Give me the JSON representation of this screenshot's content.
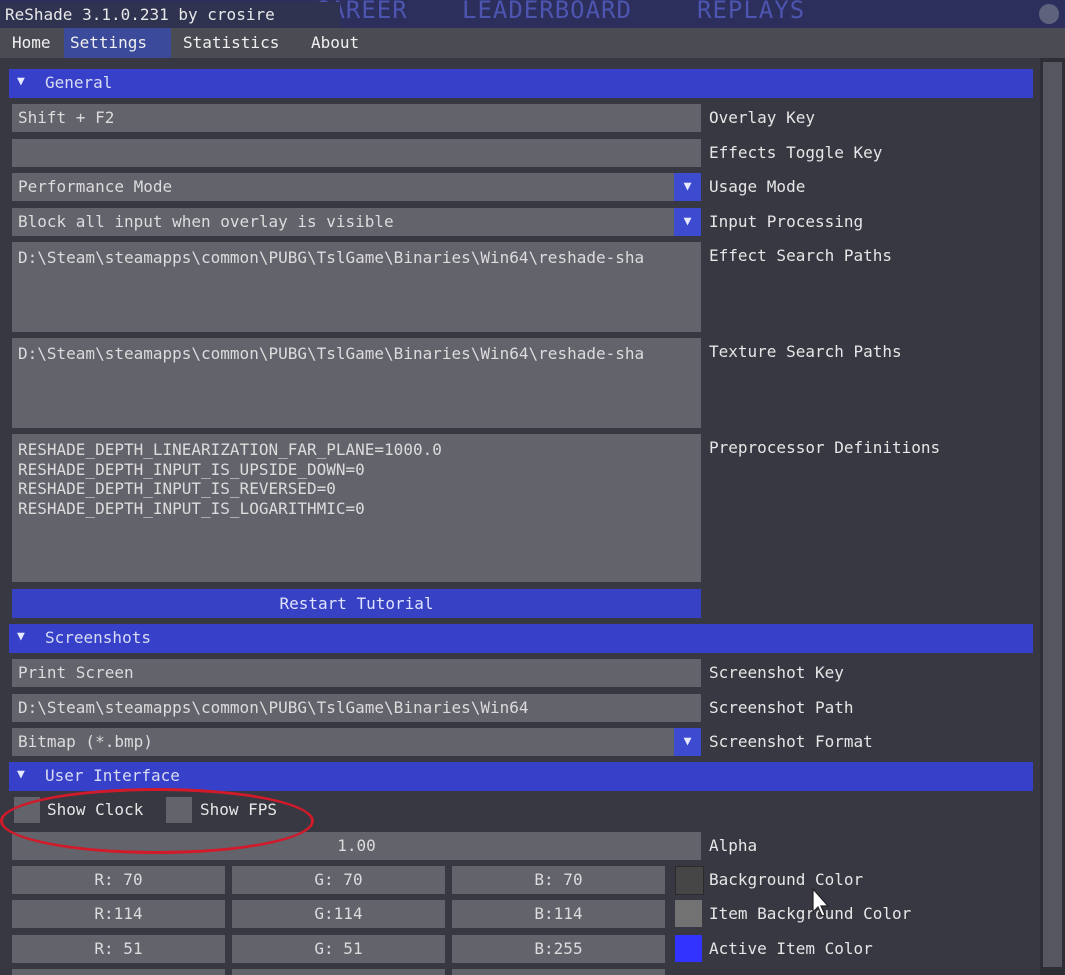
{
  "background_app": {
    "tabs": [
      "CAREER",
      "LEADERBOARD",
      "REPLAYS"
    ],
    "accent": "#4d55b0"
  },
  "window": {
    "title": "ReShade 3.1.0.231 by crosire"
  },
  "menu": {
    "items": [
      "Home",
      "Settings",
      "Statistics",
      "About"
    ],
    "active": "Settings"
  },
  "colors": {
    "section_header": "#3640c8",
    "field": "#62636b",
    "highlight_annotation": "#d11a2a"
  },
  "general": {
    "header": "General",
    "overlay_key": {
      "value": "Shift + F2",
      "label": "Overlay Key"
    },
    "effects_toggle_key": {
      "value": "",
      "label": "Effects Toggle Key"
    },
    "usage_mode": {
      "value": "Performance Mode",
      "label": "Usage Mode"
    },
    "input_processing": {
      "value": "Block all input when overlay is visible",
      "label": "Input Processing"
    },
    "effect_search_paths": {
      "value": "D:\\Steam\\steamapps\\common\\PUBG\\TslGame\\Binaries\\Win64\\reshade-sha",
      "label": "Effect Search Paths"
    },
    "texture_search_paths": {
      "value": "D:\\Steam\\steamapps\\common\\PUBG\\TslGame\\Binaries\\Win64\\reshade-sha",
      "label": "Texture Search Paths"
    },
    "preprocessor_definitions": {
      "value": "RESHADE_DEPTH_LINEARIZATION_FAR_PLANE=1000.0\nRESHADE_DEPTH_INPUT_IS_UPSIDE_DOWN=0\nRESHADE_DEPTH_INPUT_IS_REVERSED=0\nRESHADE_DEPTH_INPUT_IS_LOGARITHMIC=0",
      "label": "Preprocessor Definitions"
    },
    "restart_tutorial": "Restart Tutorial"
  },
  "screenshots": {
    "header": "Screenshots",
    "key": {
      "value": "Print Screen",
      "label": "Screenshot Key"
    },
    "path": {
      "value": "D:\\Steam\\steamapps\\common\\PUBG\\TslGame\\Binaries\\Win64",
      "label": "Screenshot Path"
    },
    "format": {
      "value": "Bitmap (*.bmp)",
      "label": "Screenshot Format"
    }
  },
  "user_interface": {
    "header": "User Interface",
    "show_clock": {
      "label": "Show Clock",
      "checked": false
    },
    "show_fps": {
      "label": "Show FPS",
      "checked": false
    },
    "alpha": {
      "value": "1.00",
      "label": "Alpha"
    },
    "background_color": {
      "r": "R: 70",
      "g": "G: 70",
      "b": "B: 70",
      "swatch": "#464646",
      "label": "Background Color"
    },
    "item_background_color": {
      "r": "R:114",
      "g": "G:114",
      "b": "B:114",
      "swatch": "#727272",
      "label": "Item Background Color"
    },
    "active_item_color": {
      "r": "R: 51",
      "g": "G: 51",
      "b": "B:255",
      "swatch": "#3333ff",
      "label": "Active Item Color"
    }
  }
}
